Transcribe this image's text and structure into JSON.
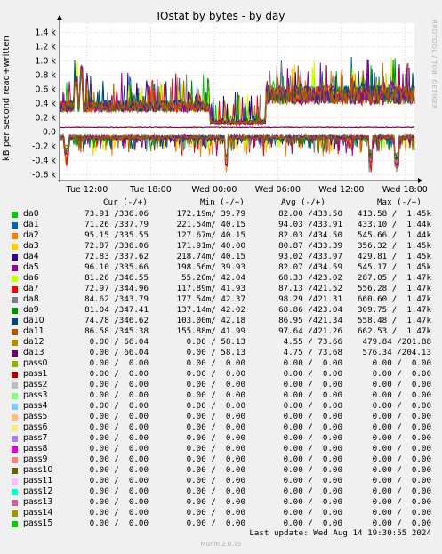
{
  "chart_data": {
    "type": "line",
    "title": "IOstat by bytes - by day",
    "ylabel": "kB per second read+written",
    "watermark": "RRDTOOL / TOBI OETIKER",
    "y_ticks": [
      {
        "value": 1400,
        "label": "1.4 k"
      },
      {
        "value": 1200,
        "label": "1.2 k"
      },
      {
        "value": 1000,
        "label": "1.0 k"
      },
      {
        "value": 800,
        "label": "0.8 k"
      },
      {
        "value": 600,
        "label": "0.6 k"
      },
      {
        "value": 400,
        "label": "0.4 k"
      },
      {
        "value": 200,
        "label": "0.2 k"
      },
      {
        "value": 0,
        "label": "0.0"
      },
      {
        "value": -200,
        "label": "-0.2 k"
      },
      {
        "value": -400,
        "label": "-0.4 k"
      },
      {
        "value": -600,
        "label": "-0.6 k"
      }
    ],
    "ylim": [
      -680,
      1530
    ],
    "x_ticks": [
      {
        "hours": 2.6,
        "label": "Tue 12:00"
      },
      {
        "hours": 8.6,
        "label": "Tue 18:00"
      },
      {
        "hours": 14.6,
        "label": "Wed 00:00"
      },
      {
        "hours": 20.6,
        "label": "Wed 06:00"
      },
      {
        "hours": 26.6,
        "label": "Wed 12:00"
      },
      {
        "hours": 32.6,
        "label": "Wed 18:00"
      }
    ],
    "x_range_hours": [
      0,
      33.5
    ],
    "series": [
      {
        "name": "da0",
        "color": "#00cc00"
      },
      {
        "name": "da1",
        "color": "#0066b3"
      },
      {
        "name": "da2",
        "color": "#ff8000"
      },
      {
        "name": "da3",
        "color": "#ffcc00"
      },
      {
        "name": "da4",
        "color": "#330099"
      },
      {
        "name": "da5",
        "color": "#990099"
      },
      {
        "name": "da6",
        "color": "#ccff00"
      },
      {
        "name": "da7",
        "color": "#ff0000"
      },
      {
        "name": "da8",
        "color": "#808080"
      },
      {
        "name": "da9",
        "color": "#008f00"
      },
      {
        "name": "da10",
        "color": "#00487d"
      },
      {
        "name": "da11",
        "color": "#b35a00"
      },
      {
        "name": "da12",
        "color": "#b38f00"
      },
      {
        "name": "da13",
        "color": "#6b006b"
      }
    ],
    "approx_levels": {
      "upper_band_center": 380,
      "upper_band_spike_max": 1460,
      "lower_band_center": -40,
      "lower_band_min": -560
    }
  },
  "legend": {
    "header": {
      "cur": "Cur (-/+)",
      "min": "Min (-/+)",
      "avg": "Avg (-/+)",
      "max": "Max (-/+)"
    },
    "rows": [
      {
        "name": "da0",
        "color": "#00cc00",
        "cur": " 73.91 /336.06",
        "min": "172.19m/ 39.79",
        "avg": " 82.00 /433.50",
        "max": " 413.58 /  1.45k"
      },
      {
        "name": "da1",
        "color": "#0066b3",
        "cur": " 71.26 /337.79",
        "min": "221.54m/ 40.15",
        "avg": " 94.03 /433.91",
        "max": " 433.10 /  1.44k"
      },
      {
        "name": "da2",
        "color": "#ff8000",
        "cur": " 95.15 /335.55",
        "min": "127.67m/ 40.15",
        "avg": " 82.03 /434.50",
        "max": " 545.66 /  1.44k"
      },
      {
        "name": "da3",
        "color": "#ffcc00",
        "cur": " 72.87 /336.06",
        "min": "171.91m/ 40.00",
        "avg": " 80.87 /433.39",
        "max": " 356.32 /  1.45k"
      },
      {
        "name": "da4",
        "color": "#330099",
        "cur": " 72.83 /337.62",
        "min": "218.74m/ 40.15",
        "avg": " 93.02 /433.97",
        "max": " 429.81 /  1.45k"
      },
      {
        "name": "da5",
        "color": "#990099",
        "cur": " 96.10 /335.66",
        "min": "198.56m/ 39.93",
        "avg": " 82.07 /434.59",
        "max": " 545.17 /  1.45k"
      },
      {
        "name": "da6",
        "color": "#ccff00",
        "cur": " 81.26 /346.55",
        "min": " 55.20m/ 42.04",
        "avg": " 68.33 /423.02",
        "max": " 287.05 /  1.47k"
      },
      {
        "name": "da7",
        "color": "#ff0000",
        "cur": " 72.97 /344.96",
        "min": "117.89m/ 41.93",
        "avg": " 87.13 /421.52",
        "max": " 556.28 /  1.47k"
      },
      {
        "name": "da8",
        "color": "#808080",
        "cur": " 84.62 /343.79",
        "min": "177.54m/ 42.37",
        "avg": " 98.29 /421.31",
        "max": " 660.60 /  1.47k"
      },
      {
        "name": "da9",
        "color": "#008f00",
        "cur": " 81.04 /347.41",
        "min": "137.14m/ 42.02",
        "avg": " 68.86 /423.04",
        "max": " 309.75 /  1.47k"
      },
      {
        "name": "da10",
        "color": "#00487d",
        "cur": " 74.78 /346.62",
        "min": "103.00m/ 42.18",
        "avg": " 86.95 /421.34",
        "max": " 558.48 /  1.47k"
      },
      {
        "name": "da11",
        "color": "#b35a00",
        "cur": " 86.58 /345.38",
        "min": "155.88m/ 41.99",
        "avg": " 97.64 /421.26",
        "max": " 662.53 /  1.47k"
      },
      {
        "name": "da12",
        "color": "#b38f00",
        "cur": "  0.00 / 66.04",
        "min": "  0.00 / 58.13",
        "avg": "  4.55 / 73.66",
        "max": " 479.84 /201.88"
      },
      {
        "name": "da13",
        "color": "#6b006b",
        "cur": "  0.00 / 66.04",
        "min": "  0.00 / 58.13",
        "avg": "  4.75 / 73.68",
        "max": " 576.34 /204.13"
      },
      {
        "name": "pass0",
        "color": "#8fb300",
        "cur": "  0.00 /  0.00",
        "min": "  0.00 /  0.00",
        "avg": "  0.00 /  0.00",
        "max": "   0.00 /  0.00"
      },
      {
        "name": "pass1",
        "color": "#b30000",
        "cur": "  0.00 /  0.00",
        "min": "  0.00 /  0.00",
        "avg": "  0.00 /  0.00",
        "max": "   0.00 /  0.00"
      },
      {
        "name": "pass2",
        "color": "#bebebe",
        "cur": "  0.00 /  0.00",
        "min": "  0.00 /  0.00",
        "avg": "  0.00 /  0.00",
        "max": "   0.00 /  0.00"
      },
      {
        "name": "pass3",
        "color": "#80ff80",
        "cur": "  0.00 /  0.00",
        "min": "  0.00 /  0.00",
        "avg": "  0.00 /  0.00",
        "max": "   0.00 /  0.00"
      },
      {
        "name": "pass4",
        "color": "#80c9ff",
        "cur": "  0.00 /  0.00",
        "min": "  0.00 /  0.00",
        "avg": "  0.00 /  0.00",
        "max": "   0.00 /  0.00"
      },
      {
        "name": "pass5",
        "color": "#ffc080",
        "cur": "  0.00 /  0.00",
        "min": "  0.00 /  0.00",
        "avg": "  0.00 /  0.00",
        "max": "   0.00 /  0.00"
      },
      {
        "name": "pass6",
        "color": "#ffe680",
        "cur": "  0.00 /  0.00",
        "min": "  0.00 /  0.00",
        "avg": "  0.00 /  0.00",
        "max": "   0.00 /  0.00"
      },
      {
        "name": "pass7",
        "color": "#aa80ff",
        "cur": "  0.00 /  0.00",
        "min": "  0.00 /  0.00",
        "avg": "  0.00 /  0.00",
        "max": "   0.00 /  0.00"
      },
      {
        "name": "pass8",
        "color": "#ee00cc",
        "cur": "  0.00 /  0.00",
        "min": "  0.00 /  0.00",
        "avg": "  0.00 /  0.00",
        "max": "   0.00 /  0.00"
      },
      {
        "name": "pass9",
        "color": "#ff8080",
        "cur": "  0.00 /  0.00",
        "min": "  0.00 /  0.00",
        "avg": "  0.00 /  0.00",
        "max": "   0.00 /  0.00"
      },
      {
        "name": "pass10",
        "color": "#666600",
        "cur": "  0.00 /  0.00",
        "min": "  0.00 /  0.00",
        "avg": "  0.00 /  0.00",
        "max": "   0.00 /  0.00"
      },
      {
        "name": "pass11",
        "color": "#ffbfff",
        "cur": "  0.00 /  0.00",
        "min": "  0.00 /  0.00",
        "avg": "  0.00 /  0.00",
        "max": "   0.00 /  0.00"
      },
      {
        "name": "pass12",
        "color": "#00ffcc",
        "cur": "  0.00 /  0.00",
        "min": "  0.00 /  0.00",
        "avg": "  0.00 /  0.00",
        "max": "   0.00 /  0.00"
      },
      {
        "name": "pass13",
        "color": "#cc6699",
        "cur": "  0.00 /  0.00",
        "min": "  0.00 /  0.00",
        "avg": "  0.00 /  0.00",
        "max": "   0.00 /  0.00"
      },
      {
        "name": "pass14",
        "color": "#999900",
        "cur": "  0.00 /  0.00",
        "min": "  0.00 /  0.00",
        "avg": "  0.00 /  0.00",
        "max": "   0.00 /  0.00"
      },
      {
        "name": "pass15",
        "color": "#00cc00",
        "cur": "  0.00 /  0.00",
        "min": "  0.00 /  0.00",
        "avg": "  0.00 /  0.00",
        "max": "   0.00 /  0.00"
      }
    ]
  },
  "footer": {
    "last_update": "Last update: Wed Aug 14 19:30:55 2024",
    "version": "Munin 2.0.75"
  }
}
